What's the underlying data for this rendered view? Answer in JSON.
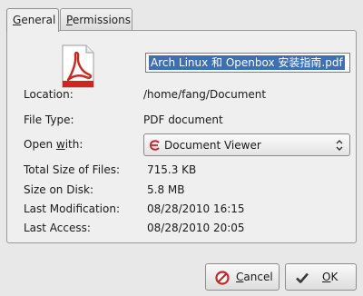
{
  "tabs": [
    {
      "label": "General",
      "underline_char": "G",
      "rest": "eneral"
    },
    {
      "label": "Permissions",
      "underline_char": "P",
      "rest": "ermissions"
    }
  ],
  "filename": "Arch Linux 和 Openbox 安装指南.pdf",
  "fields": {
    "location": {
      "label": "Location:",
      "value": "/home/fang/Document"
    },
    "file_type": {
      "label": "File Type:",
      "value": "PDF document"
    },
    "open_with": {
      "label_pre": "Open ",
      "label_u": "w",
      "label_post": "ith:",
      "value": "Document Viewer"
    },
    "total_size": {
      "label": "Total Size of Files:",
      "value": "715.3 KB"
    },
    "size_on_disk": {
      "label": "Size on Disk:",
      "value": "5.8 MB"
    },
    "last_modification": {
      "label": "Last Modification:",
      "value": "08/28/2010 16:15"
    },
    "last_access": {
      "label": "Last Access:",
      "value": "08/28/2010 20:05"
    }
  },
  "buttons": {
    "cancel": {
      "u": "C",
      "rest": "ancel"
    },
    "ok": {
      "u": "O",
      "rest": "K"
    }
  },
  "colors": {
    "selection": "#3d6fb4",
    "pdf_red": "#d0261e",
    "cancel_red": "#c62828",
    "ok_check": "#3a3a3a"
  }
}
